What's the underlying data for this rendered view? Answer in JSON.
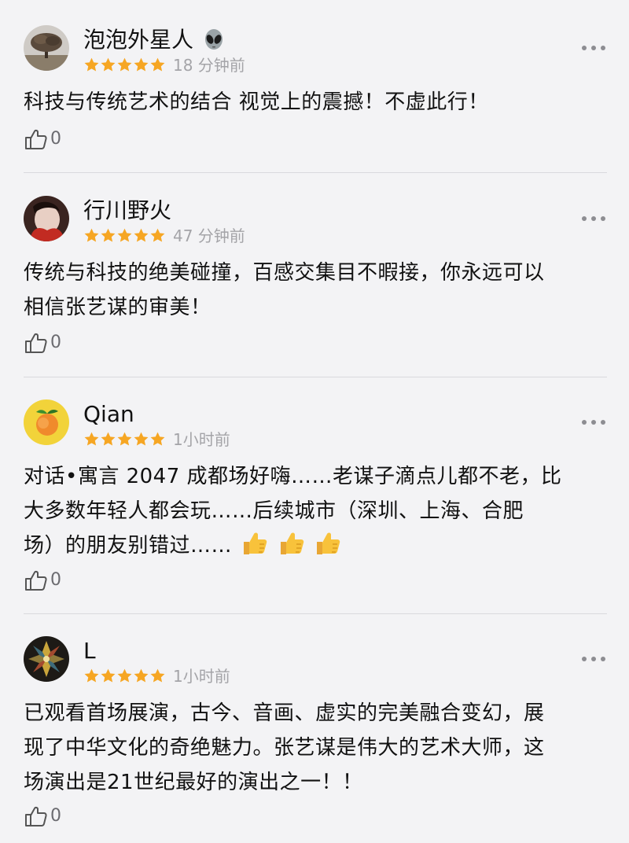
{
  "comments": [
    {
      "username": "泡泡外星人",
      "username_icon": "alien-emoji-icon",
      "rating": 5,
      "time": "18 分钟前",
      "lines": [
        "科技与传统艺术的结合 视觉上的震撼！不虚此行！"
      ],
      "likes": "0"
    },
    {
      "username": "行川野火",
      "rating": 5,
      "time": "47 分钟前",
      "lines": [
        "传统与科技的绝美碰撞，百感交集目不暇接，你永远可以",
        "相信张艺谋的审美！"
      ],
      "likes": "0"
    },
    {
      "username": "Qian",
      "rating": 5,
      "time": "1小时前",
      "lines": [
        "对话•寓言 2047 成都场好嗨……老谋子滴点儿都不老，比",
        "大多数年轻人都会玩……后续城市（深圳、上海、合肥",
        "场）的朋友别错过……"
      ],
      "trailing_emoji": "thumbs-up-emoji-icon x3",
      "likes": "0"
    },
    {
      "username": "L",
      "rating": 5,
      "time": "1小时前",
      "lines": [
        "已观看首场展演，古今、音画、虚实的完美融合变幻，展",
        "现了中华文化的奇绝魅力。张艺谋是伟大的艺术大师，这",
        "场演出是21世纪最好的演出之一！！"
      ],
      "likes": "0"
    }
  ],
  "colors": {
    "background": "#f3f3f5",
    "star": "#f6a623",
    "time": "#a4a4a8",
    "divider": "#d9d9dd"
  }
}
